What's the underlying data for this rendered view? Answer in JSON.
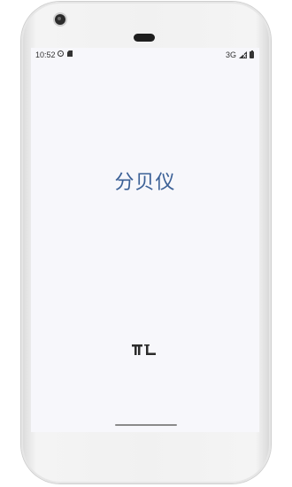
{
  "status_bar": {
    "time": "10:52",
    "network": "3G",
    "icons": [
      "settings-icon",
      "sd-card-icon",
      "signal-icon",
      "battery-icon"
    ]
  },
  "splash": {
    "app_name": "分贝仪",
    "logo_text": "TL"
  },
  "colors": {
    "title": "#3b6096",
    "screen_bg": "#f7f7fb",
    "device_frame": "#f1f1f1"
  }
}
